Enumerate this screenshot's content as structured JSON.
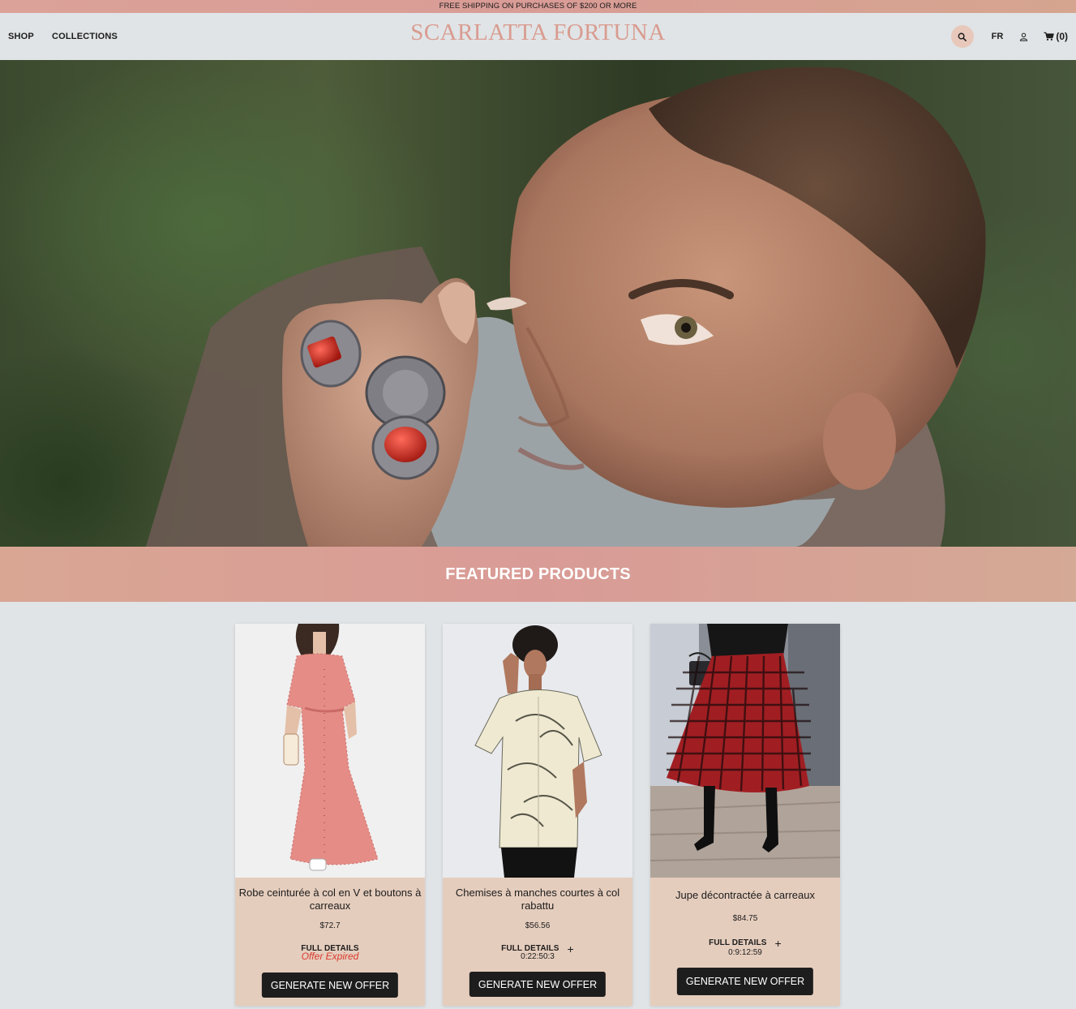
{
  "announcement": "FREE SHIPPING ON PURCHASES OF $200 OR MORE",
  "header": {
    "nav": [
      "SHOP",
      "COLLECTIONS"
    ],
    "logo": "SCARLATTA FORTUNA",
    "lang": "FR",
    "cart_count": "(0)"
  },
  "featured": {
    "title": "FEATURED PRODUCTS"
  },
  "products": [
    {
      "title": "Robe ceinturée à col en V et boutons à carreaux",
      "price": "$72.7",
      "details": "FULL DETAILS",
      "status": "Offer Expired",
      "button": "GENERATE NEW OFFER"
    },
    {
      "title": "Chemises à manches courtes à col rabattu",
      "price": "$56.56",
      "details": "FULL DETAILS",
      "timer": "0:22:50:3",
      "button": "GENERATE NEW OFFER"
    },
    {
      "title": "Jupe décontractée à carreaux",
      "price": "$84.75",
      "details": "FULL DETAILS",
      "timer": "0:9:12:59",
      "button": "GENERATE NEW OFFER"
    }
  ],
  "icons": {
    "search": "search-icon",
    "account": "user-icon",
    "cart": "cart-icon",
    "plus": "plus-icon"
  },
  "colors": {
    "brand": "#d99b90",
    "announcement_bg": "#d99c96",
    "card_bg": "#e5cdbd",
    "button_bg": "#1d1d1d",
    "expired": "#d93a2e"
  }
}
